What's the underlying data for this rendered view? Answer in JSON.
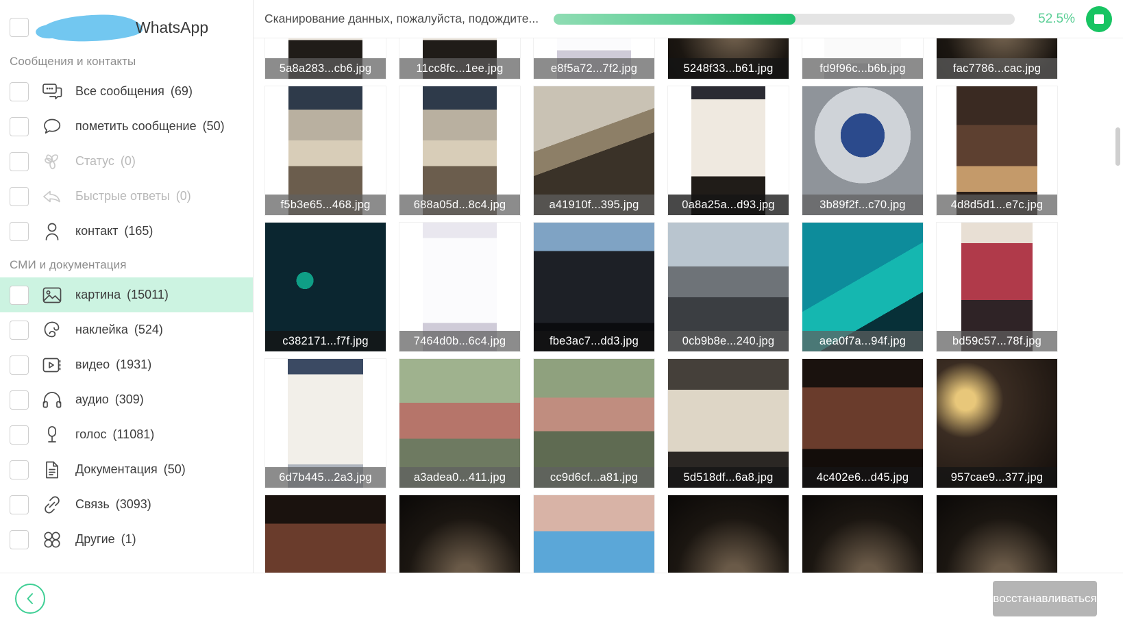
{
  "sidebar": {
    "brand": {
      "name": "WhatsApp",
      "redaction_color": "#72c7f0"
    },
    "groups": [
      {
        "title": "Сообщения и контакты",
        "items": [
          {
            "icon": "chats-icon",
            "label": "Все сообщения",
            "count": "(69)",
            "dim": false,
            "active": false
          },
          {
            "icon": "message-bubble-icon",
            "label": "пометить сообщение",
            "count": "(50)",
            "dim": false,
            "active": false
          },
          {
            "icon": "status-flower-icon",
            "label": "Статус",
            "count": "(0)",
            "dim": true,
            "active": false
          },
          {
            "icon": "reply-arrow-icon",
            "label": "Быстрые ответы",
            "count": "(0)",
            "dim": true,
            "active": false
          },
          {
            "icon": "contact-person-icon",
            "label": "контакт",
            "count": "(165)",
            "dim": false,
            "active": false
          }
        ]
      },
      {
        "title": "СМИ и документация",
        "items": [
          {
            "icon": "picture-icon",
            "label": "картина",
            "count": "(15011)",
            "dim": false,
            "active": true
          },
          {
            "icon": "sticker-icon",
            "label": "наклейка",
            "count": "(524)",
            "dim": false,
            "active": false
          },
          {
            "icon": "video-icon",
            "label": "видео",
            "count": "(1931)",
            "dim": false,
            "active": false
          },
          {
            "icon": "headphones-icon",
            "label": "аудио",
            "count": "(309)",
            "dim": false,
            "active": false
          },
          {
            "icon": "microphone-icon",
            "label": "голос",
            "count": "(11081)",
            "dim": false,
            "active": false
          },
          {
            "icon": "document-icon",
            "label": "Документация",
            "count": "(50)",
            "dim": false,
            "active": false
          },
          {
            "icon": "link-icon",
            "label": "Связь",
            "count": "(3093)",
            "dim": false,
            "active": false
          },
          {
            "icon": "others-circles-icon",
            "label": "Другие",
            "count": "(1)",
            "dim": false,
            "active": false
          }
        ]
      }
    ]
  },
  "topbar": {
    "scan_text": "Сканирование данных, пожалуйста, подождите...",
    "progress_percent": 52.5,
    "progress_label": "52.5%",
    "progress_fill_color": "#3fcf95",
    "progress_track_color": "#e4e4e4",
    "stop_button": {
      "icon": "stop-square-icon",
      "color": "#17c462"
    }
  },
  "grid": {
    "columns": 6,
    "tiles": [
      {
        "filename": "5a8a283...cb6.jpg",
        "ph": "ph-doc2",
        "dark": false,
        "partial": true
      },
      {
        "filename": "11cc8fc...1ee.jpg",
        "ph": "ph-doc2",
        "dark": false,
        "partial": true
      },
      {
        "filename": "e8f5a72...7f2.jpg",
        "ph": "ph-paper",
        "dark": false,
        "partial": true
      },
      {
        "filename": "5248f33...b61.jpg",
        "ph": "ph-dark",
        "dark": true,
        "partial": true
      },
      {
        "filename": "fd9f96c...b6b.jpg",
        "ph": "ph-doc",
        "dark": false,
        "partial": true
      },
      {
        "filename": "fac7786...cac.jpg",
        "ph": "ph-dark",
        "dark": false,
        "partial": true
      },
      {
        "filename": "f5b3e65...468.jpg",
        "ph": "ph-cake",
        "dark": false,
        "partial": false
      },
      {
        "filename": "688a05d...8c4.jpg",
        "ph": "ph-cake",
        "dark": false,
        "partial": false
      },
      {
        "filename": "a41910f...395.jpg",
        "ph": "ph-card",
        "dark": false,
        "partial": false
      },
      {
        "filename": "0a8a25a...d93.jpg",
        "ph": "ph-doc2",
        "dark": true,
        "partial": false
      },
      {
        "filename": "3b89f2f...c70.jpg",
        "ph": "ph-bottle",
        "dark": false,
        "partial": false
      },
      {
        "filename": "4d8d5d1...e7c.jpg",
        "ph": "ph-cakechoc",
        "dark": false,
        "partial": false
      },
      {
        "filename": "c382171...f7f.jpg",
        "ph": "ph-dash",
        "dark": true,
        "partial": false
      },
      {
        "filename": "7464d0b...6c4.jpg",
        "ph": "ph-paper",
        "dark": false,
        "partial": false
      },
      {
        "filename": "fbe3ac7...dd3.jpg",
        "ph": "ph-car",
        "dark": true,
        "partial": false
      },
      {
        "filename": "0cb9b8e...240.jpg",
        "ph": "ph-road",
        "dark": false,
        "partial": false
      },
      {
        "filename": "aea0f7a...94f.jpg",
        "ph": "ph-tv",
        "dark": false,
        "partial": false
      },
      {
        "filename": "bd59c57...78f.jpg",
        "ph": "ph-book",
        "dark": false,
        "partial": false
      },
      {
        "filename": "6d7b445...2a3.jpg",
        "ph": "ph-poster",
        "dark": false,
        "partial": false
      },
      {
        "filename": "a3adea0...411.jpg",
        "ph": "ph-bldg",
        "dark": false,
        "partial": false
      },
      {
        "filename": "cc9d6cf...a81.jpg",
        "ph": "ph-bldg2",
        "dark": false,
        "partial": false
      },
      {
        "filename": "5d518df...6a8.jpg",
        "ph": "ph-boards",
        "dark": true,
        "partial": false
      },
      {
        "filename": "4c402e6...d45.jpg",
        "ph": "ph-brick",
        "dark": true,
        "partial": false
      },
      {
        "filename": "957cae9...377.jpg",
        "ph": "ph-room",
        "dark": true,
        "partial": false
      },
      {
        "filename": "",
        "ph": "ph-brick",
        "dark": false,
        "partial": true
      },
      {
        "filename": "",
        "ph": "ph-dark",
        "dark": false,
        "partial": true
      },
      {
        "filename": "",
        "ph": "ph-blue",
        "dark": false,
        "partial": true
      },
      {
        "filename": "",
        "ph": "ph-dark",
        "dark": false,
        "partial": true
      },
      {
        "filename": "",
        "ph": "ph-dark",
        "dark": false,
        "partial": true
      },
      {
        "filename": "",
        "ph": "ph-dark",
        "dark": false,
        "partial": true
      }
    ]
  },
  "footer": {
    "back_icon": "chevron-left-icon",
    "restore_label": "восстанавливаться"
  }
}
